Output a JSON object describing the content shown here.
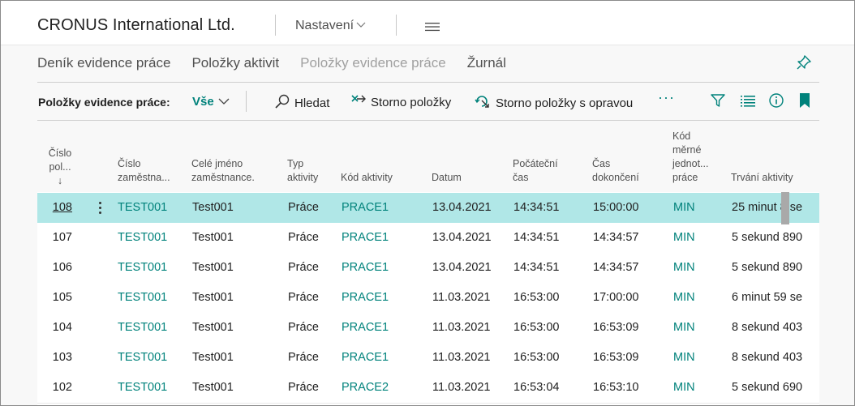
{
  "header": {
    "company": "CRONUS International Ltd.",
    "settings_label": "Nastavení"
  },
  "nav": {
    "items": [
      {
        "label": "Deník evidence práce",
        "active": false
      },
      {
        "label": "Položky aktivit",
        "active": false
      },
      {
        "label": "Položky evidence práce",
        "active": true
      },
      {
        "label": "Žurnál",
        "active": false
      }
    ]
  },
  "actions": {
    "title": "Položky evidence práce:",
    "filter_value": "Vše",
    "search_label": "Hledat",
    "storno_label": "Storno položky",
    "storno_fix_label": "Storno položky s opravou",
    "more_label": "···"
  },
  "table": {
    "columns": {
      "entry_no": [
        "Číslo",
        "pol..."
      ],
      "sort_arrow": "↓",
      "employee_no": [
        "Číslo",
        "zaměstna..."
      ],
      "full_name": [
        "Celé jméno",
        "zaměstnance."
      ],
      "activity_type": [
        "Typ",
        "aktivity"
      ],
      "activity_code": [
        "Kód aktivity"
      ],
      "date": [
        "Datum"
      ],
      "start_time": [
        "Počáteční",
        "čas"
      ],
      "end_time": [
        "Čas",
        "dokončení"
      ],
      "uom": [
        "Kód",
        "měrné",
        "jednot...",
        "práce"
      ],
      "duration": [
        "Trvání aktivity"
      ]
    },
    "rows": [
      {
        "entry_no": "108",
        "employee_no": "TEST001",
        "full_name": "Test001",
        "activity_type": "Práce",
        "activity_code": "PRACE1",
        "date": "13.04.2021",
        "start_time": "14:34:51",
        "end_time": "15:00:00",
        "uom": "MIN",
        "duration": "25 minut 8 se"
      },
      {
        "entry_no": "107",
        "employee_no": "TEST001",
        "full_name": "Test001",
        "activity_type": "Práce",
        "activity_code": "PRACE1",
        "date": "13.04.2021",
        "start_time": "14:34:51",
        "end_time": "14:34:57",
        "uom": "MIN",
        "duration": "5 sekund 890"
      },
      {
        "entry_no": "106",
        "employee_no": "TEST001",
        "full_name": "Test001",
        "activity_type": "Práce",
        "activity_code": "PRACE1",
        "date": "13.04.2021",
        "start_time": "14:34:51",
        "end_time": "14:34:57",
        "uom": "MIN",
        "duration": "5 sekund 890"
      },
      {
        "entry_no": "105",
        "employee_no": "TEST001",
        "full_name": "Test001",
        "activity_type": "Práce",
        "activity_code": "PRACE1",
        "date": "11.03.2021",
        "start_time": "16:53:00",
        "end_time": "17:00:00",
        "uom": "MIN",
        "duration": "6 minut 59 se"
      },
      {
        "entry_no": "104",
        "employee_no": "TEST001",
        "full_name": "Test001",
        "activity_type": "Práce",
        "activity_code": "PRACE1",
        "date": "11.03.2021",
        "start_time": "16:53:00",
        "end_time": "16:53:09",
        "uom": "MIN",
        "duration": "8 sekund 403"
      },
      {
        "entry_no": "103",
        "employee_no": "TEST001",
        "full_name": "Test001",
        "activity_type": "Práce",
        "activity_code": "PRACE1",
        "date": "11.03.2021",
        "start_time": "16:53:00",
        "end_time": "16:53:09",
        "uom": "MIN",
        "duration": "8 sekund 403"
      },
      {
        "entry_no": "102",
        "employee_no": "TEST001",
        "full_name": "Test001",
        "activity_type": "Práce",
        "activity_code": "PRACE2",
        "date": "11.03.2021",
        "start_time": "16:53:04",
        "end_time": "16:53:10",
        "uom": "MIN",
        "duration": "5 sekund 690"
      }
    ]
  },
  "colors": {
    "accent": "#00827b",
    "selected_row": "#b0e7e7",
    "text": "#212121"
  },
  "icons": {
    "settings_caret": "chevron-down-icon",
    "menu": "hamburger-icon",
    "pin": "pin-icon",
    "search": "search-icon",
    "storno": "undo-icon",
    "storno_fix": "redo-fix-icon",
    "filter": "filter-icon",
    "list": "list-view-icon",
    "info": "info-icon",
    "bookmark": "bookmark-icon"
  }
}
